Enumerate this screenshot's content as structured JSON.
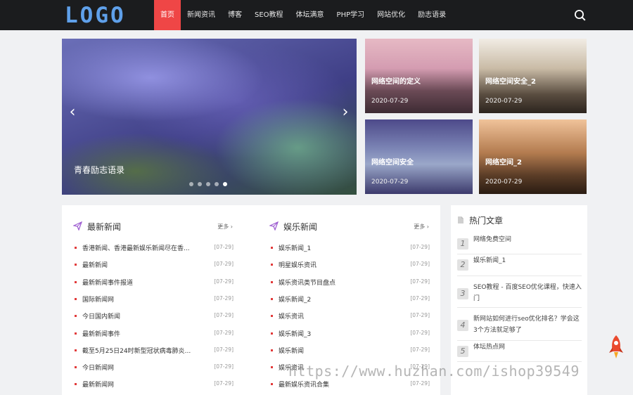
{
  "header": {
    "logo": "LOGO",
    "nav": [
      "首页",
      "新闻资讯",
      "博客",
      "SEO教程",
      "体坛满意",
      "PHP学习",
      "网站优化",
      "励志语录"
    ],
    "active_index": 0
  },
  "hero": {
    "caption": "青春励志语录",
    "prev": "‹",
    "next": "›",
    "slide_count": 5,
    "active_slide": 5
  },
  "tiles": [
    {
      "title": "网络空间的定义",
      "date": "2020-07-29"
    },
    {
      "title": "网络空间安全_2",
      "date": "2020-07-29"
    },
    {
      "title": "网络空间安全",
      "date": "2020-07-29"
    },
    {
      "title": "网络空间_2",
      "date": "2020-07-29"
    }
  ],
  "latest": {
    "title": "最新新闻",
    "more": "更多 ›",
    "items": [
      {
        "text": "香港新闻、香港最新娱乐新闻尽在香...",
        "date": "[07-29]"
      },
      {
        "text": "最新新闻",
        "date": "[07-29]"
      },
      {
        "text": "最新新闻事件报道",
        "date": "[07-29]"
      },
      {
        "text": "国际新闻网",
        "date": "[07-29]"
      },
      {
        "text": "今日国内新闻",
        "date": "[07-29]"
      },
      {
        "text": "最新新闻事件",
        "date": "[07-29]"
      },
      {
        "text": "截至5月25日24时新型冠状病毒肺炎...",
        "date": "[07-29]"
      },
      {
        "text": "今日新闻网",
        "date": "[07-29]"
      },
      {
        "text": "最新新闻网",
        "date": "[07-29]"
      }
    ]
  },
  "ent": {
    "title": "娱乐新闻",
    "more": "更多 ›",
    "items": [
      {
        "text": "娱乐新闻_1",
        "date": "[07-29]"
      },
      {
        "text": "明星娱乐资讯",
        "date": "[07-29]"
      },
      {
        "text": "娱乐资讯类节目盘点",
        "date": "[07-29]"
      },
      {
        "text": "娱乐新闻_2",
        "date": "[07-29]"
      },
      {
        "text": "娱乐资讯",
        "date": "[07-29]"
      },
      {
        "text": "娱乐新闻_3",
        "date": "[07-29]"
      },
      {
        "text": "娱乐新闻",
        "date": "[07-29]"
      },
      {
        "text": "娱乐资讯",
        "date": "[07-29]"
      },
      {
        "text": "最新娱乐资讯合集",
        "date": "[07-29]"
      }
    ]
  },
  "hot": {
    "title": "热门文章",
    "items": [
      {
        "num": "1",
        "text": "网络免费空间"
      },
      {
        "num": "2",
        "text": "娱乐新闻_1"
      },
      {
        "num": "3",
        "text": "SEO教程 - 百度SEO优化课程，快速入门"
      },
      {
        "num": "4",
        "text": "新网站如何进行seo优化排名？学会这3个方法就足够了"
      },
      {
        "num": "5",
        "text": "体坛热点网"
      }
    ]
  },
  "watermark": "https://www.huzhan.com/ishop39549",
  "colors": {
    "accent": "#ef4646",
    "logo": "#5fa0ea",
    "topbar": "#1b1c1e",
    "bullet": "#e23b3b"
  }
}
